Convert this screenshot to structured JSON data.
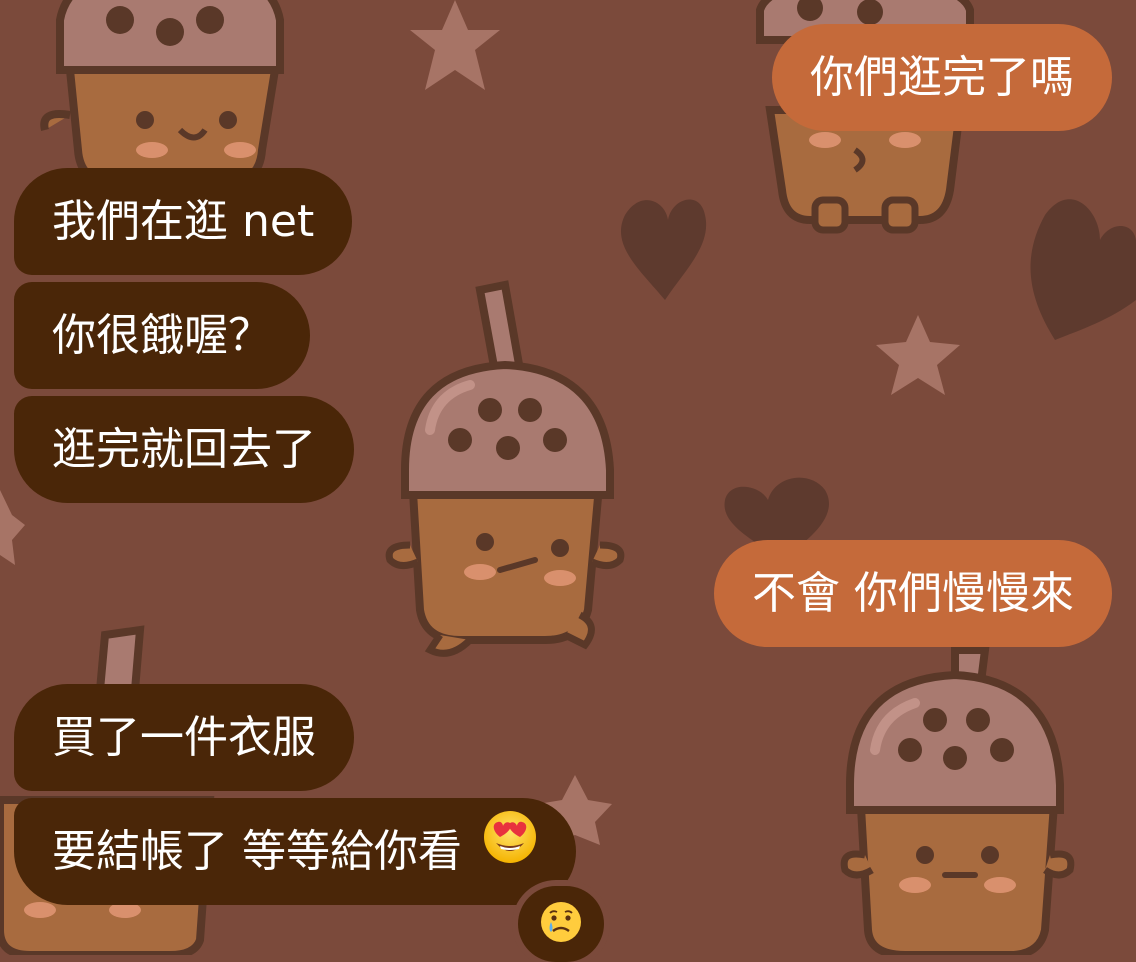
{
  "chat": {
    "messages": [
      {
        "id": "m1",
        "side": "outgoing",
        "text": "你們逛完了嗎"
      },
      {
        "id": "m2",
        "side": "incoming",
        "text": "我們在逛 net"
      },
      {
        "id": "m3",
        "side": "incoming",
        "text": "你很餓喔？"
      },
      {
        "id": "m4",
        "side": "incoming",
        "text": "逛完就回去了"
      },
      {
        "id": "m5",
        "side": "outgoing",
        "text": "不會 你們慢慢來"
      },
      {
        "id": "m6",
        "side": "incoming",
        "text": "買了一件衣服"
      },
      {
        "id": "m7",
        "side": "incoming",
        "text": "要結帳了 等等給你看",
        "emoji": "heart-eyes-emoji"
      }
    ],
    "reaction": {
      "emoji": "crying-face-emoji"
    }
  },
  "colors": {
    "background": "#7b4a3b",
    "incoming_bubble": "#4a2608",
    "outgoing_bubble": "#c56a3a",
    "text": "#ffffff"
  },
  "wallpaper": {
    "theme": "bubble-tea characters with stars and hearts",
    "icons": [
      "bubble-tea-icon",
      "star-icon",
      "heart-icon"
    ]
  }
}
